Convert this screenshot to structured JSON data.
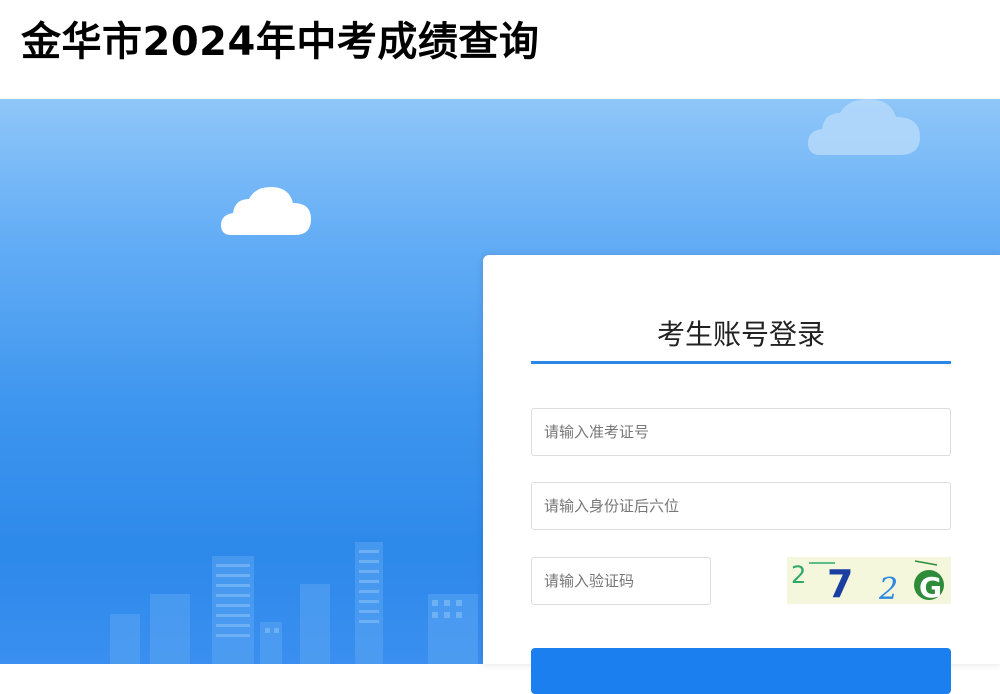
{
  "header": {
    "title": "金华市2024年中考成绩查询"
  },
  "login": {
    "title": "考生账号登录",
    "exam_id_placeholder": "请输入准考证号",
    "id_card_placeholder": "请输入身份证后六位",
    "captcha_placeholder": "请输入验证码",
    "captcha_text": "2 7 2 G",
    "button_label": "",
    "accent_color": "#1c7ff0"
  },
  "icons": [
    "cloud-icon",
    "captcha-image"
  ]
}
